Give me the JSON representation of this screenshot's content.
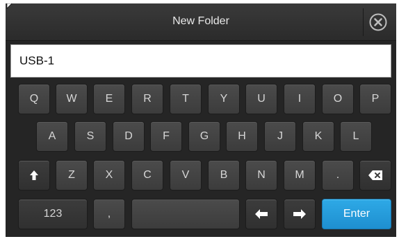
{
  "dialog": {
    "title": "New Folder",
    "close_icon": "close-circle-icon"
  },
  "input": {
    "value": "USB-1",
    "placeholder": ""
  },
  "keyboard": {
    "row1": [
      "Q",
      "W",
      "E",
      "R",
      "T",
      "Y",
      "U",
      "I",
      "O",
      "P"
    ],
    "row2": [
      "A",
      "S",
      "D",
      "F",
      "G",
      "H",
      "J",
      "K",
      "L"
    ],
    "row3": [
      "Z",
      "X",
      "C",
      "V",
      "B",
      "N",
      "M",
      "."
    ],
    "shift_icon": "arrow-up-icon",
    "backspace_icon": "backspace-icon",
    "numbers_label": "123",
    "comma_label": ",",
    "space_label": "",
    "left_arrow_icon": "arrow-left-icon",
    "right_arrow_icon": "arrow-right-icon",
    "enter_label": "Enter"
  },
  "colors": {
    "background": "#252525",
    "key": "#424242",
    "enter_key": "#2499dd",
    "key_text": "#d6d6d6"
  }
}
